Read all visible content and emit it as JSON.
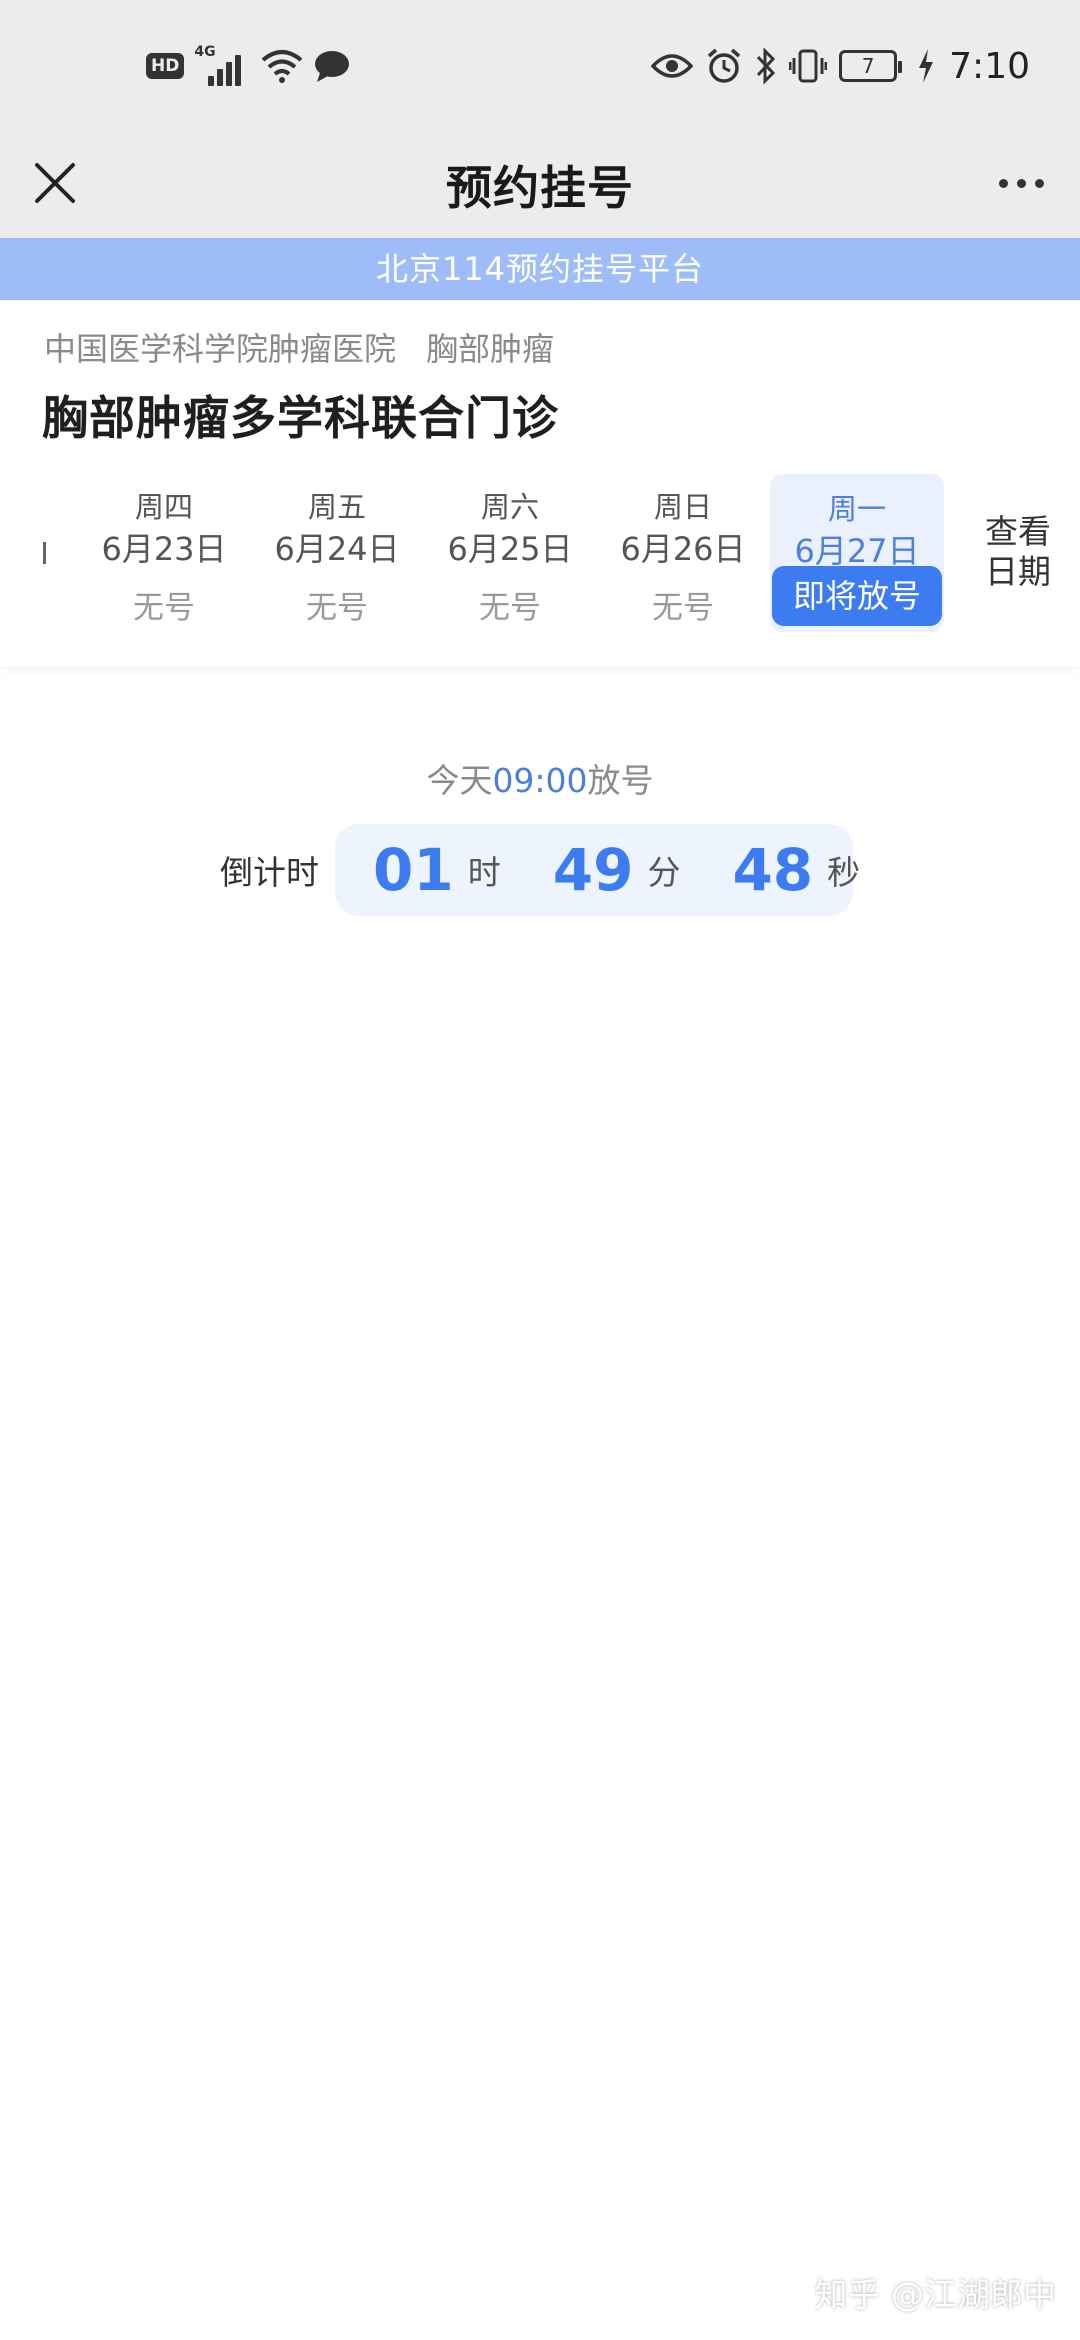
{
  "status_bar": {
    "hd": "HD",
    "network": "4G",
    "battery": "7",
    "time": "7:10"
  },
  "header": {
    "title": "预约挂号",
    "close_icon": "close-icon",
    "more_icon": "more-icon"
  },
  "banner": {
    "text": "北京114预约挂号平台"
  },
  "department": {
    "hospital": "中国医学科学院肿瘤医院",
    "section": "胸部肿瘤",
    "clinic": "胸部肿瘤多学科联合门诊"
  },
  "dates": [
    {
      "weekday": "周四",
      "date": "6月23日",
      "status": "无号"
    },
    {
      "weekday": "周五",
      "date": "6月24日",
      "status": "无号"
    },
    {
      "weekday": "周六",
      "date": "6月25日",
      "status": "无号"
    },
    {
      "weekday": "周日",
      "date": "6月26日",
      "status": "无号"
    },
    {
      "weekday": "周一",
      "date": "6月27日",
      "status": "即将放号"
    }
  ],
  "view_dates": {
    "line1": "查看",
    "line2": "日期"
  },
  "release": {
    "prefix": "今天",
    "time": "09:00",
    "suffix": "放号"
  },
  "countdown": {
    "label": "倒计时",
    "hours": "01",
    "hours_unit": "时",
    "minutes": "49",
    "minutes_unit": "分",
    "seconds": "48",
    "seconds_unit": "秒"
  },
  "watermark": "知乎 @江湖郎中",
  "colors": {
    "accent": "#3d7bf0",
    "banner": "#9ebcf7",
    "header_bg": "#ececec"
  }
}
